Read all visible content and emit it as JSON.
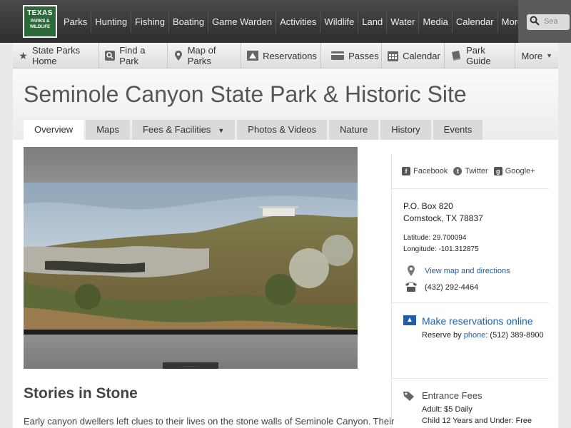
{
  "header": {
    "logo": {
      "line1": "TEXAS",
      "line2": "PARKS &",
      "line3": "WILDLIFE"
    },
    "nav": [
      "Parks",
      "Hunting",
      "Fishing",
      "Boating",
      "Game Warden",
      "Activities",
      "Wildlife",
      "Land",
      "Water",
      "Media",
      "Calendar",
      "More..."
    ],
    "search_placeholder": "Sea"
  },
  "subnav": {
    "items": [
      {
        "label": "State Parks Home",
        "icon": "star-icon"
      },
      {
        "label": "Find a Park",
        "icon": "magnifier-icon"
      },
      {
        "label": "Map of Parks",
        "icon": "map-pin-icon"
      },
      {
        "label": "Reservations",
        "icon": "tent-icon"
      },
      {
        "label": "Passes",
        "icon": "card-icon"
      },
      {
        "label": "Calendar",
        "icon": "calendar-icon"
      },
      {
        "label": "Park Guide",
        "icon": "book-icon"
      },
      {
        "label": "More",
        "icon": ""
      }
    ]
  },
  "page": {
    "title": "Seminole Canyon State Park & Historic Site",
    "tabs": [
      "Overview",
      "Maps",
      "Fees & Facilities",
      "Photos & Videos",
      "Nature",
      "History",
      "Events"
    ],
    "active_tab": "Overview",
    "pager_label": "........"
  },
  "article": {
    "heading": "Stories in Stone",
    "body": "Early canyon dwellers left clues to their lives on the stone walls of Seminole Canyon. Their"
  },
  "sidebar": {
    "social": [
      "Facebook",
      "Twitter",
      "Google+"
    ],
    "address_line1": "P.O. Box 820",
    "address_line2": "Comstock, TX 78837",
    "latitude": "Latitude: 29.700094",
    "longitude": "Longitude: -101.312875",
    "map_link": "View map and directions",
    "phone": "(432) 292-4464",
    "reservations_link": "Make reservations online",
    "reserve_prefix": "Reserve by",
    "reserve_link": "phone",
    "reserve_number": ": (512) 389-8900",
    "fees_title": "Entrance Fees",
    "fee_adult": "Adult: $5 Daily",
    "fee_child": "Child 12 Years and Under: Free"
  },
  "colors": {
    "link": "#1f5fa8",
    "topbar": "#3a3a3a",
    "logo_green": "#2d6a3a"
  }
}
